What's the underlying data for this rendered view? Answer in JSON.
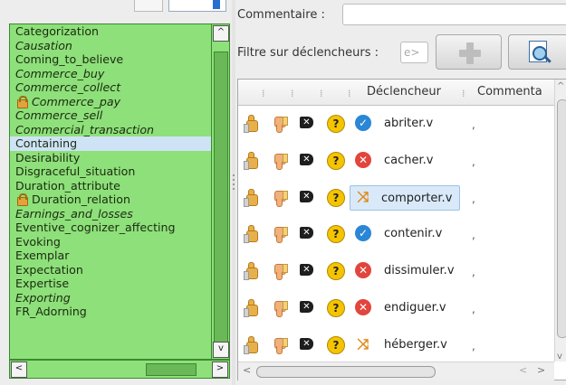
{
  "left_panel": {
    "frames": [
      {
        "label": "Categorization",
        "italic": false,
        "locked": false,
        "selected": false
      },
      {
        "label": "Causation",
        "italic": true,
        "locked": false,
        "selected": false
      },
      {
        "label": "Coming_to_believe",
        "italic": false,
        "locked": false,
        "selected": false
      },
      {
        "label": "Commerce_buy",
        "italic": true,
        "locked": false,
        "selected": false
      },
      {
        "label": "Commerce_collect",
        "italic": true,
        "locked": false,
        "selected": false
      },
      {
        "label": "Commerce_pay",
        "italic": true,
        "locked": true,
        "selected": false
      },
      {
        "label": "Commerce_sell",
        "italic": true,
        "locked": false,
        "selected": false
      },
      {
        "label": "Commercial_transaction",
        "italic": true,
        "locked": false,
        "selected": false
      },
      {
        "label": "Containing",
        "italic": false,
        "locked": false,
        "selected": true
      },
      {
        "label": "Desirability",
        "italic": false,
        "locked": false,
        "selected": false
      },
      {
        "label": "Disgraceful_situation",
        "italic": false,
        "locked": false,
        "selected": false
      },
      {
        "label": "Duration_attribute",
        "italic": false,
        "locked": false,
        "selected": false
      },
      {
        "label": "Duration_relation",
        "italic": false,
        "locked": true,
        "selected": false
      },
      {
        "label": "Earnings_and_losses",
        "italic": true,
        "locked": false,
        "selected": false
      },
      {
        "label": "Eventive_cognizer_affecting",
        "italic": false,
        "locked": false,
        "selected": false
      },
      {
        "label": "Evoking",
        "italic": false,
        "locked": false,
        "selected": false
      },
      {
        "label": "Exemplar",
        "italic": false,
        "locked": false,
        "selected": false
      },
      {
        "label": "Expectation",
        "italic": false,
        "locked": false,
        "selected": false
      },
      {
        "label": "Expertise",
        "italic": false,
        "locked": false,
        "selected": false
      },
      {
        "label": "Exporting",
        "italic": true,
        "locked": false,
        "selected": false
      },
      {
        "label": "FR_Adorning",
        "italic": false,
        "locked": false,
        "selected": false
      }
    ],
    "scroll_up": "^",
    "scroll_down": "v",
    "scroll_left": "<",
    "scroll_right": ">"
  },
  "header": {
    "comment_label": "Commentaire :",
    "comment_value": "",
    "filter_label": "Filtre sur déclencheurs :",
    "filter_placeholder": "e>"
  },
  "table": {
    "columns": [
      "Déclencheur",
      "Commenta"
    ],
    "rows": [
      {
        "lu": "abriter.v",
        "status": "ok",
        "status_glyph": "✓",
        "comment": ",",
        "selected": false
      },
      {
        "lu": "cacher.v",
        "status": "ko",
        "status_glyph": "✕",
        "comment": ",",
        "selected": false
      },
      {
        "lu": "comporter.v",
        "status": "mixed",
        "status_glyph": "⤨",
        "comment": ",",
        "selected": true
      },
      {
        "lu": "contenir.v",
        "status": "ok",
        "status_glyph": "✓",
        "comment": ",",
        "selected": false
      },
      {
        "lu": "dissimuler.v",
        "status": "ko",
        "status_glyph": "✕",
        "comment": ",",
        "selected": false
      },
      {
        "lu": "endiguer.v",
        "status": "ko",
        "status_glyph": "✕",
        "comment": ",",
        "selected": false
      },
      {
        "lu": "héberger.v",
        "status": "mixed",
        "status_glyph": "⤨",
        "comment": ",",
        "selected": false
      }
    ],
    "glyphs": {
      "delete": "✕",
      "help": "?"
    },
    "scroll_left": "<",
    "scroll_right": ">",
    "scroll_up": "^",
    "scroll_down": "v"
  },
  "colors": {
    "frame_list_bg": "#8ee07a",
    "selected_row": "#d9e9f9",
    "status_ok": "#2a86d6",
    "status_ko": "#e2453c",
    "status_mixed": "#e08a18"
  }
}
